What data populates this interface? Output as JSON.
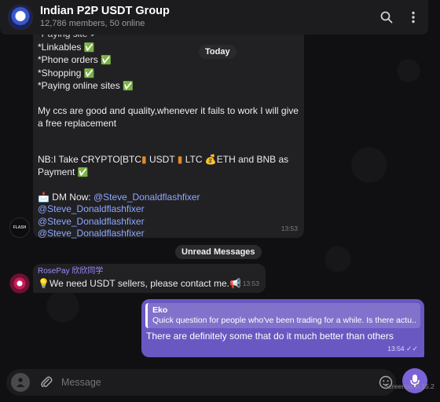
{
  "header": {
    "title": "Indian P2P USDT Group",
    "subtitle": "12,786 members, 50 online"
  },
  "date_pill": "Today",
  "message1": {
    "line_top": "*Paying site ",
    "items": [
      "*Linkables ",
      "*Phone orders ",
      "*Shopping ",
      "*Paying online sites "
    ],
    "body": "My ccs are good and quality,whenever it fails to work I will give a free replacement",
    "nb_prefix": "NB:I Take CRYPTO[BTC",
    "nb_usdt": " USDT ",
    "nb_ltc": " LTC ",
    "nb_rest": "ETH and BNB as Payment ",
    "dm_label": " DM Now: ",
    "mentions": [
      "@Steve_Donaldflashfixer",
      "@Steve_Donaldflashfixer",
      "@Steve_Donaldflashfixer",
      "@Steve_Donaldflashfixer"
    ],
    "time": "13:53",
    "avatar_text": "FLASH"
  },
  "unread_pill": "Unread Messages",
  "message2": {
    "sender": "RosePay 欣欣同学",
    "text": "We need USDT sellers, please contact me.",
    "time": "13:53"
  },
  "message3": {
    "reply_sender": "Eko",
    "reply_text": "Quick question for people who've been trading for a while. Is there actu...",
    "text": "There are definitely some that do it much better than others",
    "time": "13:54"
  },
  "input": {
    "placeholder": "Message"
  },
  "watermark": "Screenpic 0.15.2",
  "colors": {
    "accent": "#6a58c2",
    "mention": "#8ea8ff",
    "check": "#5fd16a",
    "sender": "#9b8cff"
  }
}
